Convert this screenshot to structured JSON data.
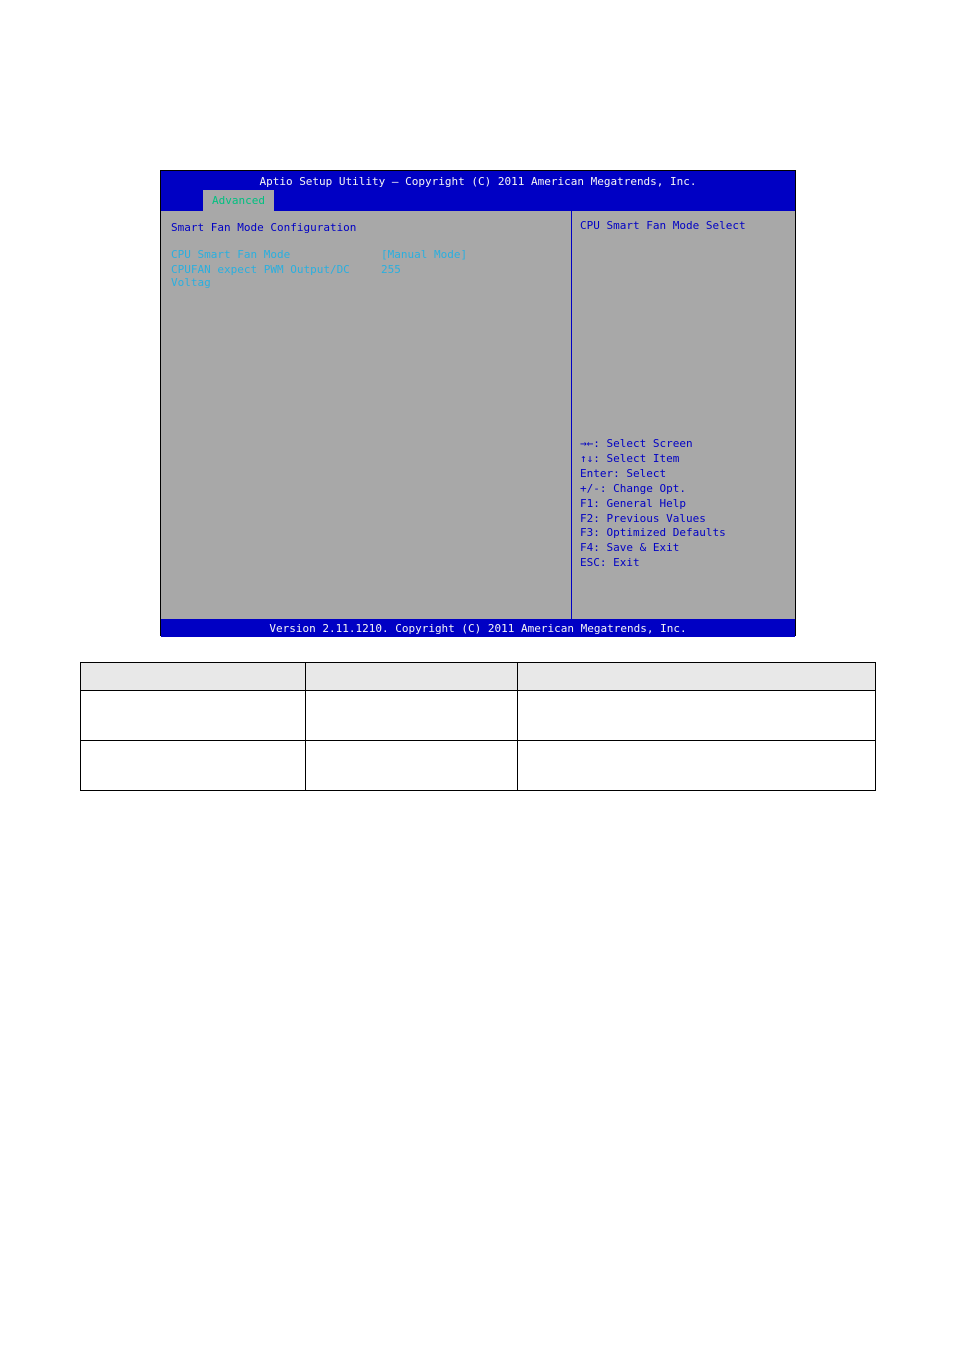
{
  "bios": {
    "title": "Aptio Setup Utility – Copyright (C) 2011 American Megatrends, Inc.",
    "tab": "Advanced",
    "section_title": "Smart Fan Mode Configuration",
    "rows": [
      {
        "label": "CPU Smart Fan Mode",
        "value": "[Manual Mode]"
      },
      {
        "label": "CPUFAN expect PWM Output/DC Voltag",
        "value": "255"
      }
    ],
    "help_top": "CPU Smart Fan Mode Select",
    "help_bottom": [
      "→←: Select Screen",
      "↑↓: Select Item",
      "Enter: Select",
      "+/-: Change Opt.",
      "F1: General Help",
      "F2: Previous Values",
      "F3: Optimized Defaults",
      "F4: Save & Exit",
      "ESC: Exit"
    ],
    "footer": "Version 2.11.1210. Copyright (C) 2011 American Megatrends, Inc."
  },
  "table": {
    "headers": [
      "",
      "",
      ""
    ],
    "rows": [
      [
        "",
        "",
        ""
      ],
      [
        "",
        "",
        ""
      ]
    ]
  }
}
